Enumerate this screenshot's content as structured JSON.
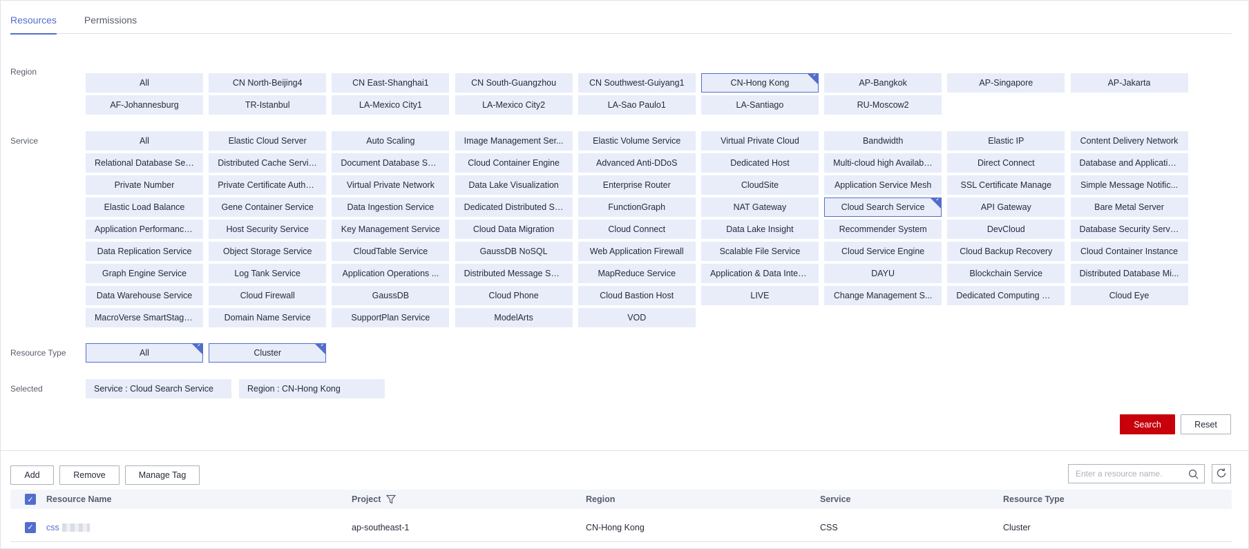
{
  "tabs": [
    {
      "label": "Resources",
      "active": true
    },
    {
      "label": "Permissions",
      "active": false
    }
  ],
  "region": {
    "label": "Region",
    "selected": "CN-Hong Kong",
    "options": [
      "All",
      "CN North-Beijing4",
      "CN East-Shanghai1",
      "CN South-Guangzhou",
      "CN Southwest-Guiyang1",
      "CN-Hong Kong",
      "AP-Bangkok",
      "AP-Singapore",
      "AP-Jakarta",
      "AF-Johannesburg",
      "TR-Istanbul",
      "LA-Mexico City1",
      "LA-Mexico City2",
      "LA-Sao Paulo1",
      "LA-Santiago",
      "RU-Moscow2"
    ]
  },
  "service": {
    "label": "Service",
    "selected": "Cloud Search Service",
    "options": [
      "All",
      "Elastic Cloud Server",
      "Auto Scaling",
      "Image Management Ser...",
      "Elastic Volume Service",
      "Virtual Private Cloud",
      "Bandwidth",
      "Elastic IP",
      "Content Delivery Network",
      "Relational Database Ser...",
      "Distributed Cache Service",
      "Document Database Ser...",
      "Cloud Container Engine",
      "Advanced Anti-DDoS",
      "Dedicated Host",
      "Multi-cloud high Availabil...",
      "Direct Connect",
      "Database and Applicatio...",
      "Private Number",
      "Private Certificate Autho...",
      "Virtual Private Network",
      "Data Lake Visualization",
      "Enterprise Router",
      "CloudSite",
      "Application Service Mesh",
      "SSL Certificate Manage",
      "Simple Message Notific...",
      "Elastic Load Balance",
      "Gene Container Service",
      "Data Ingestion Service",
      "Dedicated Distributed St...",
      "FunctionGraph",
      "NAT Gateway",
      "Cloud Search Service",
      "API Gateway",
      "Bare Metal Server",
      "Application Performance...",
      "Host Security Service",
      "Key Management Service",
      "Cloud Data Migration",
      "Cloud Connect",
      "Data Lake Insight",
      "Recommender System",
      "DevCloud",
      "Database Security Service",
      "Data Replication Service",
      "Object Storage Service",
      "CloudTable Service",
      "GaussDB NoSQL",
      "Web Application Firewall",
      "Scalable File Service",
      "Cloud Service Engine",
      "Cloud Backup Recovery",
      "Cloud Container Instance",
      "Graph Engine Service",
      "Log Tank Service",
      "Application Operations ...",
      "Distributed Message Ser...",
      "MapReduce Service",
      "Application & Data Integ...",
      "DAYU",
      "Blockchain Service",
      "Distributed Database Mi...",
      "Data Warehouse Service",
      "Cloud Firewall",
      "GaussDB",
      "Cloud Phone",
      "Cloud Bastion Host",
      "LIVE",
      "Change Management S...",
      "Dedicated Computing Cl...",
      "Cloud Eye",
      "MacroVerse SmartStage...",
      "Domain Name Service",
      "SupportPlan Service",
      "ModelArts",
      "VOD"
    ]
  },
  "resource_type": {
    "label": "Resource Type",
    "options": [
      "All",
      "Cluster"
    ],
    "selected": [
      "All",
      "Cluster"
    ]
  },
  "selected_filters": {
    "label": "Selected",
    "tags": [
      "Service : Cloud Search Service",
      "Region : CN-Hong Kong"
    ]
  },
  "actions": {
    "search": "Search",
    "reset": "Reset",
    "add": "Add",
    "remove": "Remove",
    "manage_tag": "Manage Tag"
  },
  "resource_search": {
    "placeholder": "Enter a resource name."
  },
  "table": {
    "columns": [
      "Resource Name",
      "Project",
      "Region",
      "Service",
      "Resource Type"
    ],
    "rows": [
      {
        "name": "css",
        "project": "ap-southeast-1",
        "region": "CN-Hong Kong",
        "service": "CSS",
        "type": "Cluster"
      }
    ]
  },
  "colors": {
    "accent": "#526ecc",
    "primary_button": "#c7000b",
    "chip_bg": "#e8edf9"
  }
}
